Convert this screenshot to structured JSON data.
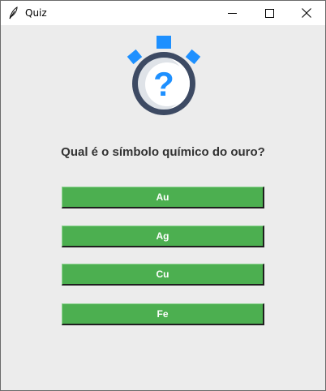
{
  "window": {
    "title": "Quiz",
    "app_icon": "feather-icon"
  },
  "titlebar_controls": [
    "minimize-icon",
    "maximize-icon",
    "close-icon"
  ],
  "hero_icon": "stopwatch-question-icon",
  "colors": {
    "accent_blue": "#1e90ff",
    "ring_dark": "#3d4a63",
    "answer_green": "#4caf50",
    "background": "#ececec"
  },
  "quiz": {
    "question": "Qual é o símbolo químico do ouro?",
    "options": [
      "Au",
      "Ag",
      "Cu",
      "Fe"
    ]
  }
}
